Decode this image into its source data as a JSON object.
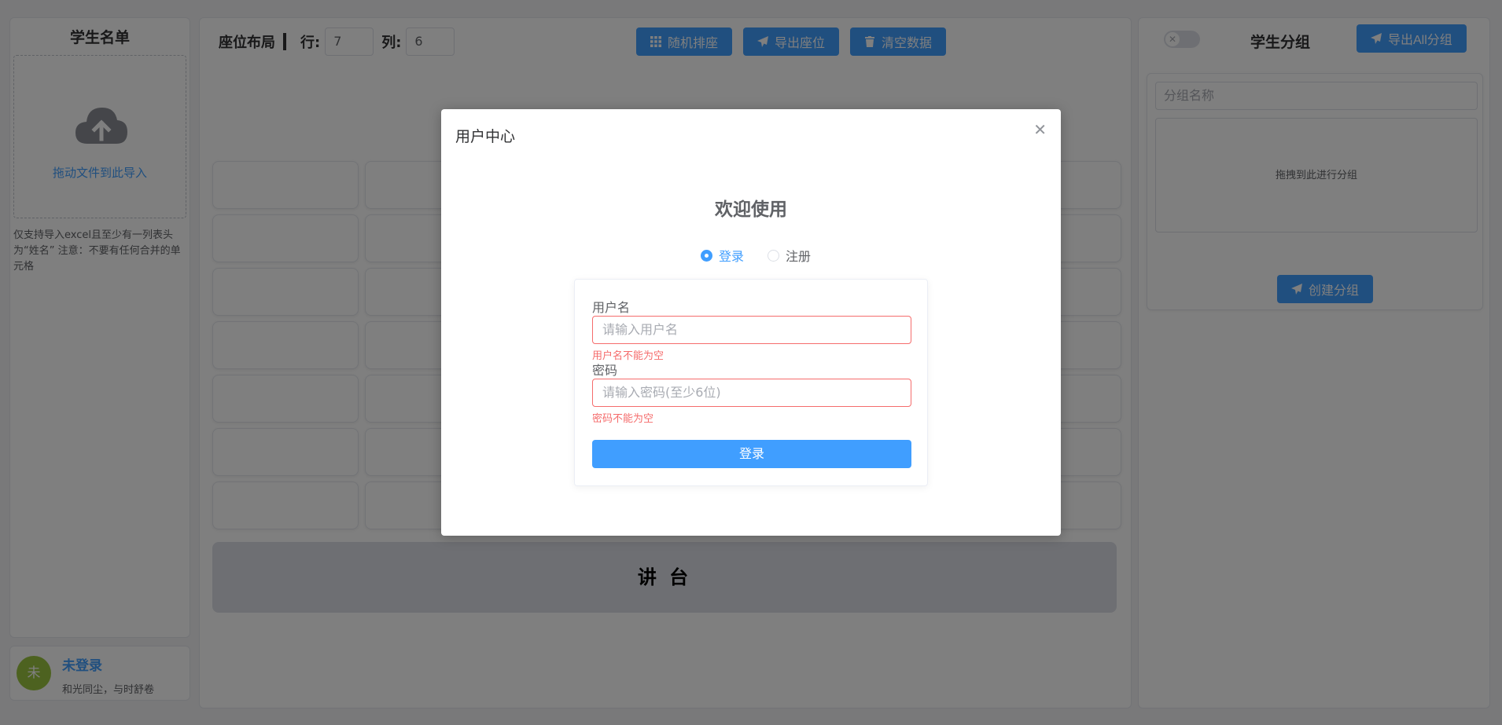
{
  "left": {
    "title": "学生名单",
    "upload_text": "拖动文件到此导入",
    "upload_tip": "仅支持导入excel且至少有一列表头为“姓名” 注意：不要有任何合并的单元格"
  },
  "user": {
    "avatar": "未",
    "name": "未登录",
    "motto": "和光同尘，与时舒卷"
  },
  "layout": {
    "label": "座位布局",
    "rows_label": "行:",
    "rows_value": "7",
    "cols_label": "列:",
    "cols_value": "6",
    "buttons": {
      "random": "随机排座",
      "export": "导出座位",
      "clear": "清空数据"
    },
    "podium": "讲 台"
  },
  "grouping": {
    "title": "学生分组",
    "export_all": "导出All分组",
    "name_placeholder": "分组名称",
    "drop_hint": "拖拽到此进行分组",
    "create": "创建分组"
  },
  "modal": {
    "title": "用户中心",
    "welcome": "欢迎使用",
    "tabs": {
      "login": "登录",
      "register": "注册"
    },
    "username_label": "用户名",
    "username_placeholder": "请输入用户名",
    "username_error": "用户名不能为空",
    "password_label": "密码",
    "password_placeholder": "请输入密码(至少6位)",
    "password_error": "密码不能为空",
    "submit": "登录"
  },
  "colors": {
    "primary": "#409eff",
    "error": "#f56c6c",
    "avatar": "#9bc540"
  }
}
